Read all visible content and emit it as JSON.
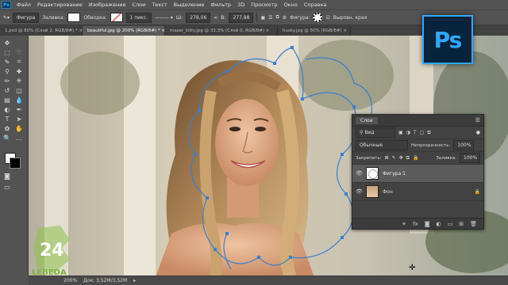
{
  "menubar": {
    "logo": "Ps",
    "items": [
      "Файл",
      "Редактирование",
      "Изображение",
      "Слои",
      "Текст",
      "Выделение",
      "Фильтр",
      "3D",
      "Просмотр",
      "Окно",
      "Справка"
    ]
  },
  "options": {
    "mode": "Фигура",
    "fill_label": "Заливка:",
    "stroke_label": "Обводка:",
    "stroke_width": "1 пикс.",
    "w_label": "Ш:",
    "w_value": "278,06",
    "h_label": "В:",
    "h_value": "277,88",
    "shape_label": "Фигура:",
    "align_edges": "Выровн. края"
  },
  "tabs": [
    {
      "label": "1.psd @ 80% (Слой 2, RGB/8#) *",
      "active": false
    },
    {
      "label": "beautiful.jpg @ 200% (RGB/8#) *",
      "active": true
    },
    {
      "label": "maser_kitty.jpg @ 33,3% (Слой 0, RGB/8#)",
      "active": false
    },
    {
      "label": "husky.jpg @ 50% (RGB/8#)",
      "active": false
    }
  ],
  "ps_logo": "Ps",
  "status": {
    "zoom": "200%",
    "doc": "Док: 3,52M/3,52M"
  },
  "watermark": {
    "number": "24",
    "text": "LEBEDA"
  },
  "layers_panel": {
    "title": "Слои",
    "filter": "Вид",
    "blend_mode": "Обычные",
    "opacity_label": "Непрозрачность:",
    "opacity_value": "100%",
    "lock_label": "Закрепить:",
    "fill_label": "Заливка:",
    "fill_value": "100%",
    "layers": [
      {
        "name": "Фигура 1",
        "selected": true
      },
      {
        "name": "Фон",
        "selected": false
      }
    ]
  },
  "colors": {
    "accent": "#31a8ff",
    "panel": "#424242",
    "path": "#3a7fd0"
  }
}
